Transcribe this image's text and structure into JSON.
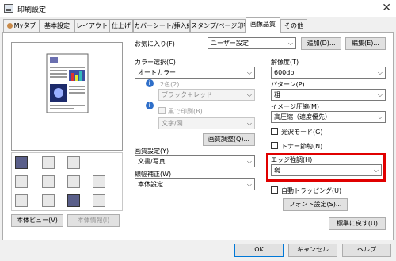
{
  "window": {
    "title": "印刷設定",
    "close": "✕"
  },
  "tabs": [
    {
      "label": "Myタブ"
    },
    {
      "label": "基本設定"
    },
    {
      "label": "レイアウト"
    },
    {
      "label": "仕上げ"
    },
    {
      "label": "カバーシート/挿入紙"
    },
    {
      "label": "スタンプ/ページ印字"
    },
    {
      "label": "画像品質"
    },
    {
      "label": "その他"
    }
  ],
  "favorites": {
    "label": "お気に入り(F)",
    "value": "ユーザー設定",
    "add_button": "追加(D)...",
    "edit_button": "編集(E)..."
  },
  "left": {
    "preview_view_button": "本体ビュー(V)",
    "device_info_button": "本体情報(I)"
  },
  "color": {
    "label": "カラー選択(C)",
    "value": "オートカラー",
    "two_color_label": "2色(2)",
    "two_color_value": "ブラック＋レッド",
    "black_print_label": "黒で印刷(B)",
    "black_print_value": "文字/図",
    "adjust_button": "画質調整(Q)..."
  },
  "quality": {
    "label": "画質設定(Y)",
    "value": "文書/写真",
    "gradation_label": "線幅補正(W)",
    "gradation_value": "本体設定"
  },
  "right": {
    "resolution_label": "解像度(T)",
    "resolution_value": "600dpi",
    "pattern_label": "パターン(P)",
    "pattern_value": "粗",
    "compression_label": "イメージ圧縮(M)",
    "compression_value": "高圧縮（速度優先）",
    "glossy_label": "光沢モード(G)",
    "toner_save_label": "トナー節約(N)",
    "edge_label": "エッジ強調(H)",
    "edge_value": "弱",
    "auto_trapping_label": "自動トラッピング(U)",
    "font_button": "フォント設定(S)..."
  },
  "reset_button": "標準に戻す(U)",
  "footer": {
    "ok": "OK",
    "cancel": "キャンセル",
    "help": "ヘルプ"
  }
}
